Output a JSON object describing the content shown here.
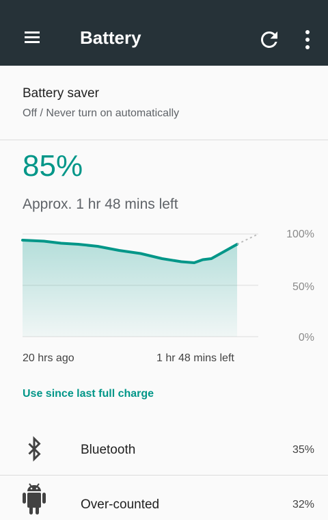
{
  "toolbar": {
    "title": "Battery",
    "menu_icon": "hamburger-menu-icon",
    "refresh_icon": "refresh-icon",
    "more_icon": "more-vert-icon",
    "background": "#263238"
  },
  "battery_saver": {
    "title": "Battery saver",
    "status": "Off / Never turn on automatically"
  },
  "battery": {
    "level": "85%",
    "estimate": "Approx. 1 hr 48 mins left"
  },
  "chart_data": {
    "type": "area",
    "title": "",
    "xlabel": "",
    "ylabel": "",
    "x_labels": [
      "20 hrs ago",
      "1 hr 48 mins left"
    ],
    "y_ticks": [
      "100%",
      "50%",
      "0%"
    ],
    "ylim": [
      0,
      100
    ],
    "grid": true,
    "series": [
      {
        "color": "#009688",
        "x": [
          0,
          10,
          18,
          26,
          35,
          45,
          55,
          65,
          74,
          80,
          84,
          88,
          94,
          100
        ],
        "values": [
          94,
          93,
          91,
          90,
          88,
          84,
          81,
          76,
          73,
          72,
          75,
          76,
          83,
          90
        ]
      }
    ],
    "projection_color": "#bdbdbd"
  },
  "usage": {
    "heading": "Use since last full charge",
    "items": [
      {
        "name": "Bluetooth",
        "percent": "35%",
        "icon": "bluetooth-icon"
      },
      {
        "name": "Over-counted",
        "percent": "32%",
        "icon": "android-icon"
      }
    ]
  },
  "colors": {
    "accent": "#009688",
    "secondary_text": "#5f6368"
  }
}
